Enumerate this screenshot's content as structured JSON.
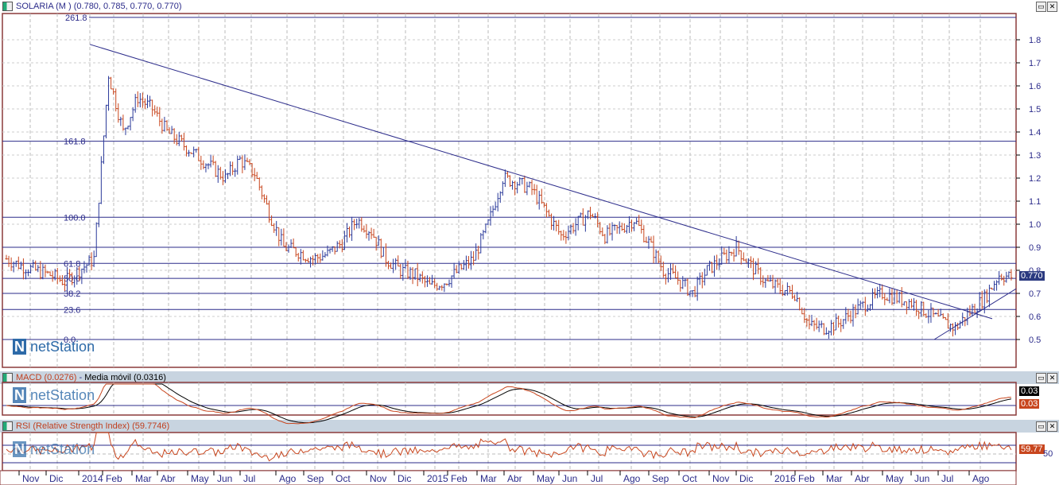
{
  "main": {
    "title": "SOLARIA (M ) (0.780, 0.785, 0.770, 0.770)",
    "last_price": "0.770",
    "logo": "netStation"
  },
  "macd": {
    "title_macd": "MACD (0.0276)",
    "title_ma": "Media móvil (0.0316)",
    "value1": "0.03",
    "value2": "0.03"
  },
  "rsi": {
    "title": "RSI (Relative Strength Index) (59.7746)",
    "value": "59.77",
    "level": "50"
  },
  "chart_data": {
    "type": "ohlc",
    "title": "SOLARIA (M )",
    "x_labels": [
      "Nov",
      "Dic",
      "2014",
      "Feb",
      "Mar",
      "Abr",
      "May",
      "Jun",
      "Jul",
      "Ago",
      "Sep",
      "Oct",
      "Nov",
      "Dic",
      "2015",
      "Feb",
      "Mar",
      "Abr",
      "May",
      "Jun",
      "Jul",
      "Ago",
      "Sep",
      "Oct",
      "Nov",
      "Dic",
      "2016",
      "Feb",
      "Mar",
      "Abr",
      "May",
      "Jun",
      "Jul",
      "Ago"
    ],
    "y_ticks": [
      1.8,
      1.7,
      1.6,
      1.5,
      1.4,
      1.3,
      1.2,
      1.1,
      1.0,
      0.9,
      0.8,
      0.7,
      0.6,
      0.5
    ],
    "ylim": [
      0.33,
      1.91
    ],
    "fib_levels": [
      {
        "label": "261.8",
        "price": 1.897
      },
      {
        "label": "161.8",
        "price": 1.36
      },
      {
        "label": "100.0",
        "price": 1.03
      },
      {
        "label": "61.8",
        "price": 0.83
      },
      {
        "label": "50.0",
        "price": 0.765
      },
      {
        "label": "38.2",
        "price": 0.7
      },
      {
        "label": "23.6",
        "price": 0.63
      },
      {
        "label": "0.0",
        "price": 0.5
      }
    ],
    "horizontal_line": 0.9,
    "closes_semimonthly": [
      0.85,
      0.82,
      0.8,
      0.78,
      0.75,
      0.8,
      0.85,
      1.65,
      1.4,
      1.55,
      1.5,
      1.4,
      1.35,
      1.3,
      1.25,
      1.2,
      1.28,
      1.22,
      1.05,
      0.9,
      0.88,
      0.85,
      0.87,
      0.92,
      1.02,
      0.97,
      0.85,
      0.8,
      0.78,
      0.73,
      0.75,
      0.8,
      0.85,
      1.0,
      1.2,
      1.18,
      1.15,
      1.05,
      0.95,
      1.0,
      1.05,
      0.95,
      0.98,
      1.02,
      0.92,
      0.8,
      0.76,
      0.7,
      0.8,
      0.85,
      0.9,
      0.82,
      0.75,
      0.72,
      0.7,
      0.56,
      0.55,
      0.57,
      0.62,
      0.66,
      0.7,
      0.68,
      0.66,
      0.62,
      0.58,
      0.55,
      0.62,
      0.68,
      0.78,
      0.77
    ],
    "trendlines": [
      {
        "from": [
          1.78,
          "2014-01"
        ],
        "to": [
          0.59,
          "2016-08"
        ]
      },
      {
        "from": [
          0.5,
          "2016-06"
        ],
        "to": [
          0.72,
          "2016-09"
        ]
      }
    ]
  }
}
